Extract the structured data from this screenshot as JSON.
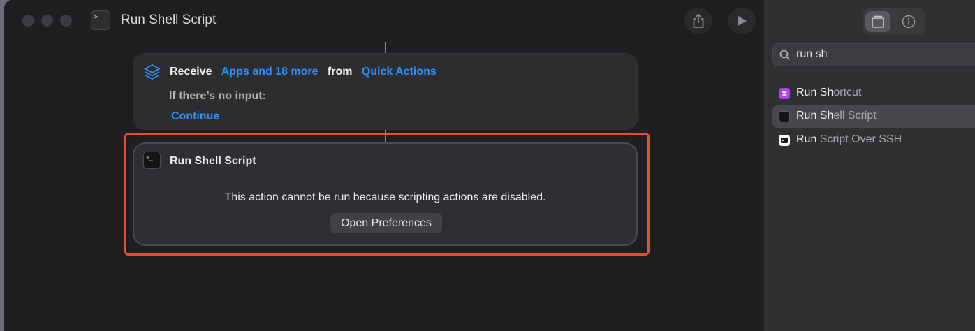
{
  "window": {
    "title": "Run Shell Script"
  },
  "receive": {
    "verb": "Receive",
    "input_types": "Apps and 18 more",
    "from_word": "from",
    "source": "Quick Actions",
    "no_input_label": "If there’s no input:",
    "no_input_action": "Continue"
  },
  "shell_action": {
    "title": "Run Shell Script",
    "message": "This action cannot be run because scripting actions are disabled.",
    "button_label": "Open Preferences",
    "icon_glyph": ">_"
  },
  "sidebar": {
    "search_value": "run sh",
    "results": [
      {
        "match": "Run Sh",
        "rest": "ortcut",
        "icon": "shortcuts-icon",
        "icon_color": "#b044e6"
      },
      {
        "match": "Run Sh",
        "rest": "ell Script",
        "icon": "terminal-icon",
        "icon_color": "#141416"
      },
      {
        "match": "Run",
        "rest": " Script Over SSH",
        "icon": "ssh-terminal-icon",
        "icon_color": "#ffffff"
      }
    ]
  },
  "colors": {
    "accent": "#2f8ff5",
    "highlight": "#e0522f"
  }
}
